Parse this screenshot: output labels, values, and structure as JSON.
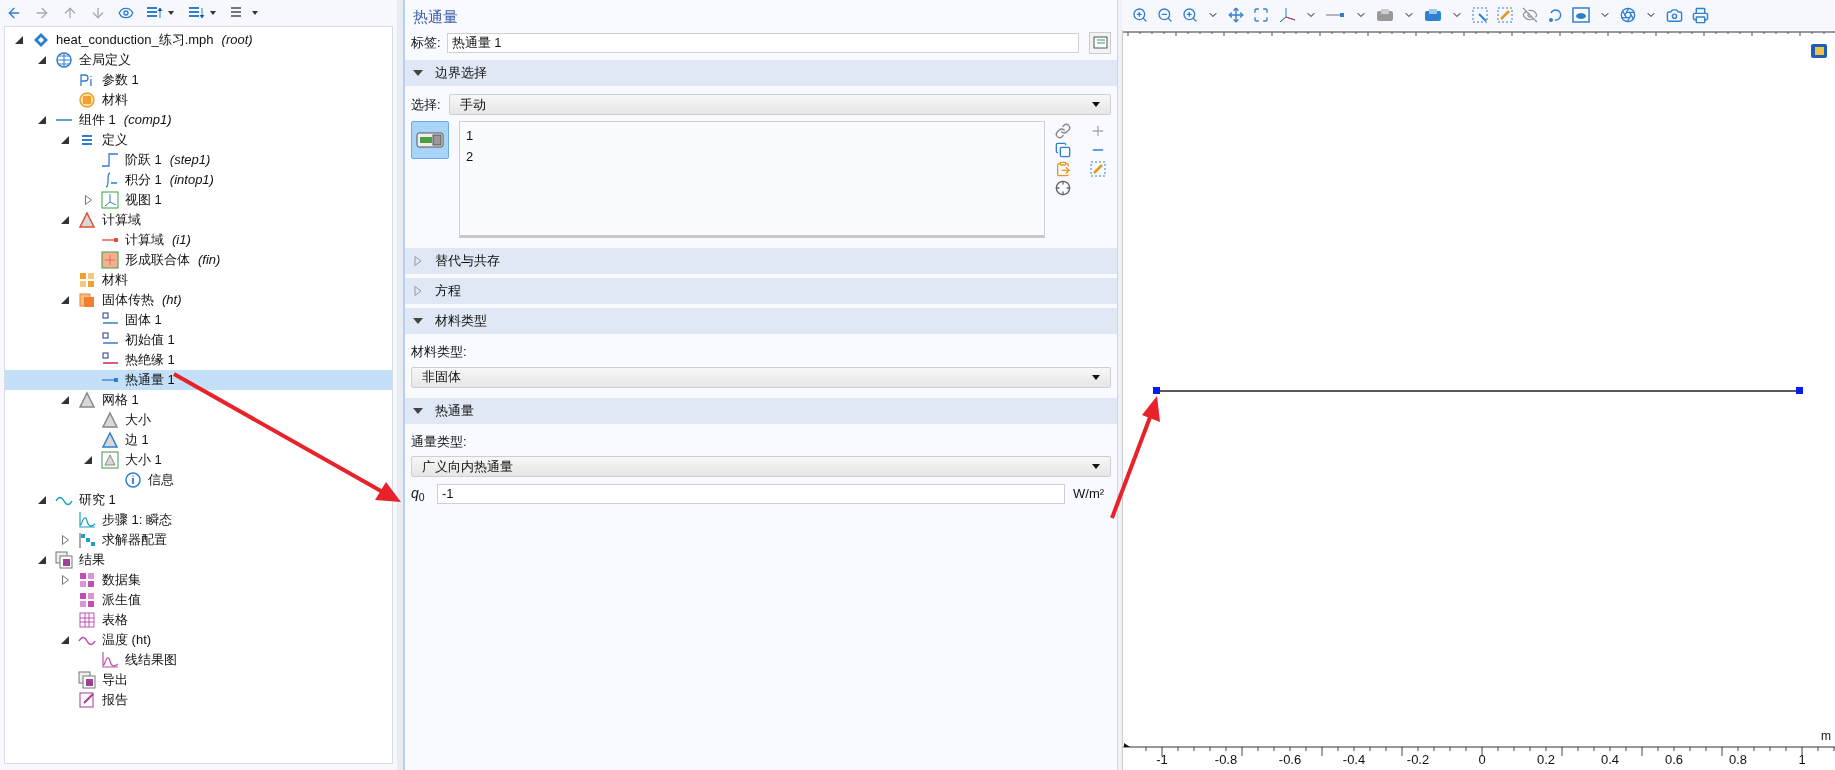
{
  "model_tree": [
    {
      "label": "heat_conduction_练习.mph",
      "tag": "(root)",
      "kind": "model",
      "expanded": true,
      "selected": false,
      "children": [
        {
          "label": "全局定义",
          "kind": "globe",
          "expanded": true,
          "selected": false,
          "children": [
            {
              "label": "参数 1",
              "kind": "parameter",
              "selected": false
            },
            {
              "label": "材料",
              "kind": "material",
              "selected": false
            }
          ]
        },
        {
          "label": "组件 1",
          "tag": "(comp1)",
          "kind": "component",
          "expanded": true,
          "selected": false,
          "children": [
            {
              "label": "定义",
              "kind": "definitions",
              "expanded": true,
              "selected": false,
              "children": [
                {
                  "label": "阶跃 1",
                  "tag": "(step1)",
                  "kind": "step",
                  "selected": false
                },
                {
                  "label": "积分 1",
                  "tag": "(intop1)",
                  "kind": "integral",
                  "selected": false
                },
                {
                  "label": "视图 1",
                  "kind": "view",
                  "expanded": false,
                  "selected": false
                }
              ]
            },
            {
              "label": "计算域",
              "kind": "geometry",
              "expanded": true,
              "selected": false,
              "children": [
                {
                  "label": "计算域",
                  "tag": "(i1)",
                  "kind": "interval",
                  "selected": false
                },
                {
                  "label": "形成联合体",
                  "tag": "(fin)",
                  "kind": "union",
                  "selected": false
                }
              ]
            },
            {
              "label": "材料",
              "kind": "materials",
              "selected": false
            },
            {
              "label": "固体传热",
              "tag": "(ht)",
              "kind": "physics",
              "expanded": true,
              "selected": false,
              "children": [
                {
                  "label": "固体 1",
                  "kind": "feature",
                  "selected": false
                },
                {
                  "label": "初始值 1",
                  "kind": "feature",
                  "selected": false
                },
                {
                  "label": "热绝缘 1",
                  "kind": "boundary",
                  "selected": false
                },
                {
                  "label": "热通量 1",
                  "kind": "flux",
                  "selected": true
                }
              ]
            },
            {
              "label": "网格 1",
              "kind": "mesh",
              "expanded": true,
              "selected": false,
              "children": [
                {
                  "label": "大小",
                  "kind": "size",
                  "selected": false
                },
                {
                  "label": "边 1",
                  "kind": "edge_mesh",
                  "selected": false
                },
                {
                  "label": "大小 1",
                  "kind": "size_box",
                  "expanded": true,
                  "selected": false,
                  "children": [
                    {
                      "label": "信息",
                      "kind": "info",
                      "selected": false
                    }
                  ]
                }
              ]
            }
          ]
        },
        {
          "label": "研究 1",
          "kind": "study",
          "expanded": true,
          "selected": false,
          "children": [
            {
              "label": "步骤 1: 瞬态",
              "kind": "study_step",
              "selected": false
            },
            {
              "label": "求解器配置",
              "kind": "solver",
              "expanded": false,
              "selected": false
            }
          ]
        },
        {
          "label": "结果",
          "kind": "results",
          "expanded": true,
          "selected": false,
          "children": [
            {
              "label": "数据集",
              "kind": "dataset",
              "expanded": false,
              "selected": false
            },
            {
              "label": "派生值",
              "kind": "derived",
              "selected": false
            },
            {
              "label": "表格",
              "kind": "table",
              "selected": false
            },
            {
              "label": "温度 (ht)",
              "kind": "plot_group",
              "expanded": true,
              "selected": false,
              "children": [
                {
                  "label": "线结果图",
                  "kind": "line_plot",
                  "selected": false
                }
              ]
            },
            {
              "label": "导出",
              "kind": "export",
              "selected": false
            },
            {
              "label": "报告",
              "kind": "report",
              "selected": false
            }
          ]
        }
      ]
    }
  ],
  "settings": {
    "title": "热通量",
    "label_field": {
      "label": "标签:",
      "value": "热通量 1"
    },
    "sections": [
      {
        "title": "边界选择",
        "expanded": true,
        "fields": [
          {
            "kind": "inline_select",
            "label": "选择:",
            "value": "手动"
          },
          {
            "kind": "selection_list",
            "active": true,
            "items": [
              "1",
              "2"
            ]
          }
        ]
      },
      {
        "title": "替代与共存",
        "expanded": false
      },
      {
        "title": "方程",
        "expanded": false
      },
      {
        "title": "材料类型",
        "expanded": true,
        "fields": [
          {
            "kind": "select",
            "label": "材料类型:",
            "value": "非固体"
          }
        ]
      },
      {
        "title": "热通量",
        "expanded": true,
        "fields": [
          {
            "kind": "select",
            "label": "通量类型:",
            "value": "广义向内热通量"
          },
          {
            "kind": "quantity",
            "symbol": "*q*$_{0}$",
            "value": "-1",
            "unit": "W/m²"
          }
        ]
      }
    ]
  },
  "graphics": {
    "x_axis": {
      "unit": "m",
      "ticks": [
        "-1",
        "-0.8",
        "-0.6",
        "-0.4",
        "-0.2",
        "0",
        "0.2",
        "0.4",
        "0.6",
        "0.8",
        "1"
      ]
    }
  }
}
